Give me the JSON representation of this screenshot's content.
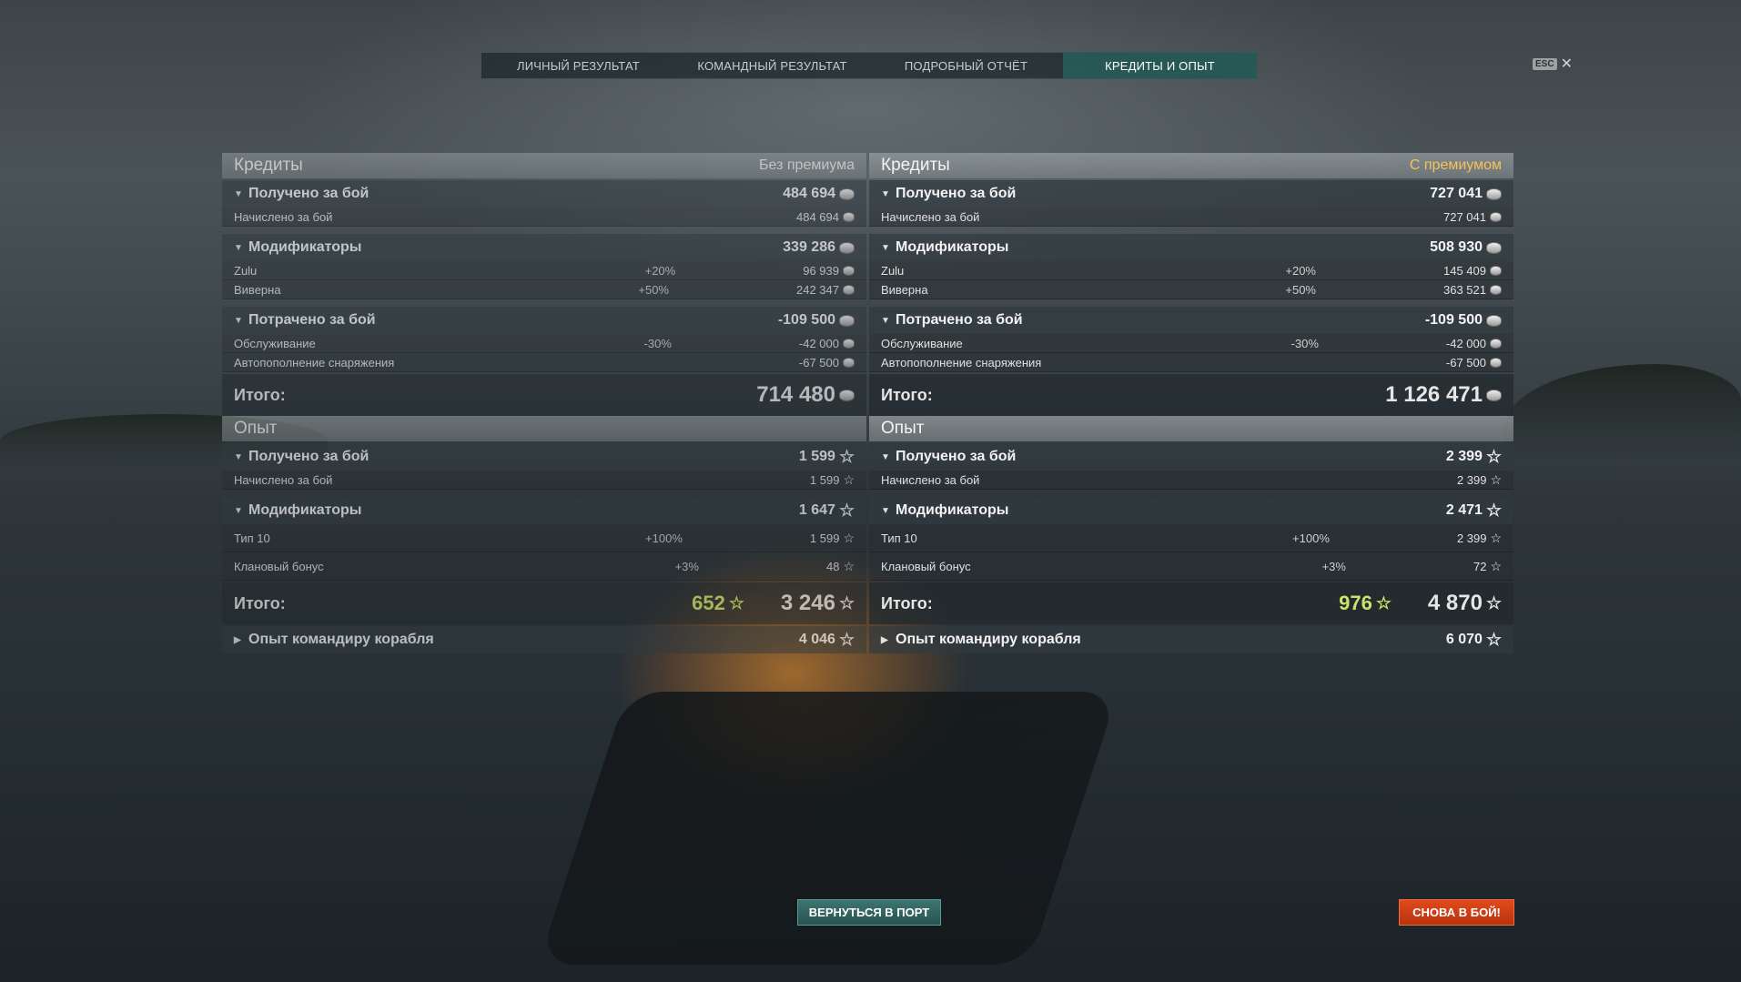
{
  "tabs": [
    {
      "label": "ЛИЧНЫЙ РЕЗУЛЬТАТ",
      "active": false
    },
    {
      "label": "КОМАНДНЫЙ РЕЗУЛЬТАТ",
      "active": false
    },
    {
      "label": "ПОДРОБНЫЙ ОТЧЁТ",
      "active": false
    },
    {
      "label": "КРЕДИТЫ И ОПЫТ",
      "active": true
    }
  ],
  "esc": {
    "key": "ESC",
    "close": "✕"
  },
  "left": {
    "credits_title": "Кредиты",
    "credits_subtitle": "Без премиума",
    "earned": {
      "label": "Получено за бой",
      "value": "484 694"
    },
    "earned_row": {
      "label": "Начислено за бой",
      "value": "484 694"
    },
    "modifiers": {
      "label": "Модификаторы",
      "value": "339 286"
    },
    "mod_rows": [
      {
        "label": "Zulu",
        "pct": "+20%",
        "value": "96 939"
      },
      {
        "label": "Виверна",
        "pct": "+50%",
        "value": "242 347"
      }
    ],
    "spent": {
      "label": "Потрачено за бой",
      "value": "-109 500"
    },
    "spent_rows": [
      {
        "label": "Обслуживание",
        "pct": "-30%",
        "value": "-42 000"
      },
      {
        "label": "Автопополнение снаряжения",
        "pct": "",
        "value": "-67 500"
      }
    ],
    "credits_total": {
      "label": "Итого:",
      "value": "714 480"
    },
    "xp_title": "Опыт",
    "xp_earned": {
      "label": "Получено за бой",
      "value": "1 599"
    },
    "xp_earned_row": {
      "label": "Начислено за бой",
      "value": "1 599"
    },
    "xp_modifiers": {
      "label": "Модификаторы",
      "value": "1 647"
    },
    "xp_mod_rows": [
      {
        "label": "Тип 10",
        "pct": "+100%",
        "value": "1 599"
      },
      {
        "label": "Клановый бонус",
        "pct": "+3%",
        "value": "48"
      }
    ],
    "xp_total": {
      "label": "Итого:",
      "free": "652",
      "value": "3 246"
    },
    "commander": {
      "label": "Опыт командиру корабля",
      "value": "4 046"
    }
  },
  "right": {
    "credits_title": "Кредиты",
    "credits_subtitle": "С премиумом",
    "earned": {
      "label": "Получено за бой",
      "value": "727 041"
    },
    "earned_row": {
      "label": "Начислено за бой",
      "value": "727 041"
    },
    "modifiers": {
      "label": "Модификаторы",
      "value": "508 930"
    },
    "mod_rows": [
      {
        "label": "Zulu",
        "pct": "+20%",
        "value": "145 409"
      },
      {
        "label": "Виверна",
        "pct": "+50%",
        "value": "363 521"
      }
    ],
    "spent": {
      "label": "Потрачено за бой",
      "value": "-109 500"
    },
    "spent_rows": [
      {
        "label": "Обслуживание",
        "pct": "-30%",
        "value": "-42 000"
      },
      {
        "label": "Автопополнение снаряжения",
        "pct": "",
        "value": "-67 500"
      }
    ],
    "credits_total": {
      "label": "Итого:",
      "value": "1 126 471"
    },
    "xp_title": "Опыт",
    "xp_earned": {
      "label": "Получено за бой",
      "value": "2 399"
    },
    "xp_earned_row": {
      "label": "Начислено за бой",
      "value": "2 399"
    },
    "xp_modifiers": {
      "label": "Модификаторы",
      "value": "2 471"
    },
    "xp_mod_rows": [
      {
        "label": "Тип 10",
        "pct": "+100%",
        "value": "2 399"
      },
      {
        "label": "Клановый бонус",
        "pct": "+3%",
        "value": "72"
      }
    ],
    "xp_total": {
      "label": "Итого:",
      "free": "976",
      "value": "4 870"
    },
    "commander": {
      "label": "Опыт командиру корабля",
      "value": "6 070"
    }
  },
  "buttons": {
    "port": "ВЕРНУТЬСЯ В ПОРТ",
    "battle": "СНОВА В БОЙ!"
  },
  "colors": {
    "premium": "#f6c25a",
    "free_xp": "#c9e46a",
    "active_tab": "#285f5a",
    "battle_button": "#d13d14"
  },
  "icons": {
    "credits": "coin-icon",
    "xp": "star-icon",
    "expand": "triangle-down-icon",
    "collapsed": "triangle-right-icon"
  }
}
